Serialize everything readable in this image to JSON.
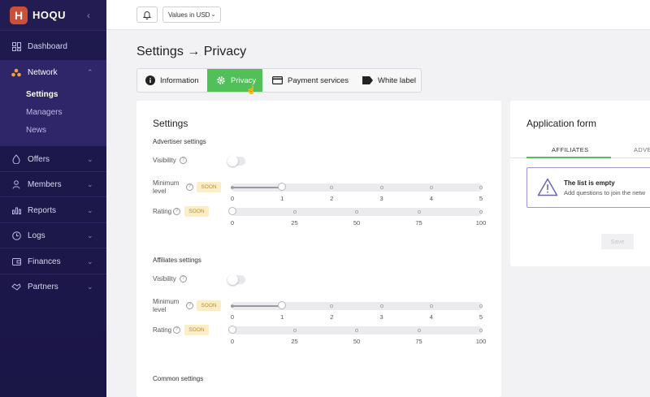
{
  "brand": {
    "logo_letter": "H",
    "name": "HOQU"
  },
  "sidebar": {
    "items": [
      {
        "label": "Dashboard"
      },
      {
        "label": "Network"
      },
      {
        "label": "Offers"
      },
      {
        "label": "Members"
      },
      {
        "label": "Reports"
      },
      {
        "label": "Logs"
      },
      {
        "label": "Finances"
      },
      {
        "label": "Partners"
      }
    ],
    "network_subitems": [
      {
        "label": "Settings",
        "active": true
      },
      {
        "label": "Managers"
      },
      {
        "label": "News"
      }
    ]
  },
  "topbar": {
    "currency": "Values in USD"
  },
  "page": {
    "title": "Settings → Privacy"
  },
  "tabs": [
    {
      "label": "Information"
    },
    {
      "label": "Privacy",
      "active": true
    },
    {
      "label": "Payment services"
    },
    {
      "label": "White label"
    }
  ],
  "settings": {
    "title": "Settings",
    "soon_label": "SOON",
    "advertiser": {
      "section": "Advertiser settings",
      "visibility_label": "Visibility",
      "min_level_label_1": "Minimum",
      "min_level_label_2": "level",
      "rating_label": "Rating",
      "level_value": 1,
      "rating_value": 0
    },
    "affiliates": {
      "section": "Affiliates settings",
      "visibility_label": "Visibility",
      "min_level_label_1": "Minimum",
      "min_level_label_2": "level",
      "rating_label": "Rating",
      "level_value": 1,
      "rating_value": 0
    },
    "common": {
      "section": "Common settings"
    },
    "level_ticks": [
      "0",
      "1",
      "2",
      "3",
      "4",
      "5"
    ],
    "rating_ticks": [
      "0",
      "25",
      "50",
      "75",
      "100"
    ]
  },
  "application_form": {
    "title": "Application form",
    "tab_affiliates": "AFFILIATES",
    "tab_advertisers": "ADVE",
    "empty_title": "The list is empty",
    "empty_sub": "Add questions to join the netw",
    "save_label": "Save"
  },
  "colors": {
    "accent": "#52c058",
    "sidebar": "#1f1a4e",
    "soon_bg": "#fbeec7"
  }
}
